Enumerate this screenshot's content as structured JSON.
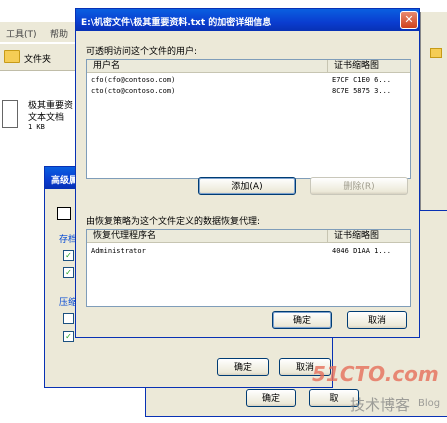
{
  "explorer": {
    "toolbar_tools": "工具(T)",
    "toolbar_help": "帮助",
    "folders_label": "文件夹",
    "file_name": "极其重要资",
    "file_type": "文本文档",
    "file_size": "1 KB"
  },
  "advanced_dialog": {
    "title": "高级属",
    "section_archive": "存档",
    "section_compress": "压缩",
    "ok_label": "确定",
    "cancel_label": "取消"
  },
  "properties_dialog": {
    "ok_label": "确定",
    "cancel_label": "取"
  },
  "detail_dialog": {
    "title": "E:\\机密文件\\极其重要资料.txt 的加密详细信息",
    "users_section_label": "可透明访问这个文件的用户:",
    "users_table": {
      "columns": [
        "用户名",
        "证书缩略图"
      ],
      "rows": [
        [
          "cfo(cfo@contoso.com)",
          "E7CF C1E0 6..."
        ],
        [
          "cto(cto@contoso.com)",
          "8C7E 5875 3..."
        ]
      ]
    },
    "add_button": "添加(A)",
    "remove_button": "删除(R)",
    "recovery_section_label": "由恢复策略为这个文件定义的数据恢复代理:",
    "recovery_table": {
      "columns": [
        "恢复代理程序名",
        "证书缩略图"
      ],
      "rows": [
        [
          "Administrator",
          "4046 D1AA 1..."
        ]
      ]
    },
    "ok_label": "确定",
    "cancel_label": "取消"
  },
  "watermark": {
    "site": "51CTO.com",
    "slogan": "技术博客",
    "blog": "Blog"
  }
}
